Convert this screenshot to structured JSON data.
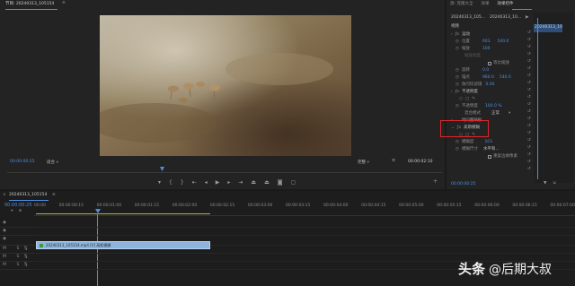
{
  "monitor": {
    "tab_label": "节目: 20240313_105154",
    "timecode_left": "00:00:00:25",
    "fit_label": "适合",
    "quality_label": "完整",
    "timecode_right": "00:00:02:10"
  },
  "effects": {
    "tabs": [
      "源: 克隆大全",
      "效果",
      "效果控件"
    ],
    "clip_name": "20240313_105...",
    "clip_tl_name": "20240313_10...",
    "clip_badge": "20240313_10523",
    "sections": {
      "video": "视频",
      "motion": "运动",
      "position": "位置",
      "position_x": "603",
      "position_y": "540.0",
      "scale": "缩放",
      "scale_val": "100",
      "scale_width": "缩放宽度",
      "uniform_scale": "等比缩放",
      "rotation": "旋转",
      "rotation_val": "0.0",
      "anchor": "锚点",
      "anchor_x": "960.0",
      "anchor_y": "540.0",
      "flicker": "防闪烁滤镜",
      "flicker_val": "0.00",
      "opacity": "不透明度",
      "opacity_val": "100.0 %",
      "blend_mode": "混合模式",
      "blend_val": "正常",
      "time_remap": "时间重映射",
      "gaussian": "高斯模糊",
      "blurriness": "模糊度",
      "blurriness_val": "103",
      "blur_dim": "模糊尺寸",
      "blur_dim_val": "水平和...",
      "repeat_edge": "重复边缘像素"
    },
    "footer_time": "00:00:00:25"
  },
  "timeline": {
    "tab_label": "20240313_105154",
    "timecode": "00:00:00:25",
    "ruler": [
      "00:00",
      "00:00:00:15",
      "00:00:01:00",
      "00:00:01:15",
      "00:00:02:00",
      "00:00:02:15",
      "00:00:03:00",
      "00:00:03:15",
      "00:00:04:00",
      "00:00:04:15",
      "00:00:05:00",
      "00:00:05:15",
      "00:00:06:00",
      "00:00:06:15",
      "00:00:07:00"
    ],
    "clip_label": "20240313_105154.mp4 [V] 高斯模糊"
  },
  "watermark": {
    "brand": "头条",
    "handle": "@后期大叔"
  },
  "colors": {
    "accent_blue": "#4d8fe0",
    "highlight_red": "#e0262b",
    "clip_blue": "#8fb4dc",
    "clip_green": "#3f9a3f"
  }
}
